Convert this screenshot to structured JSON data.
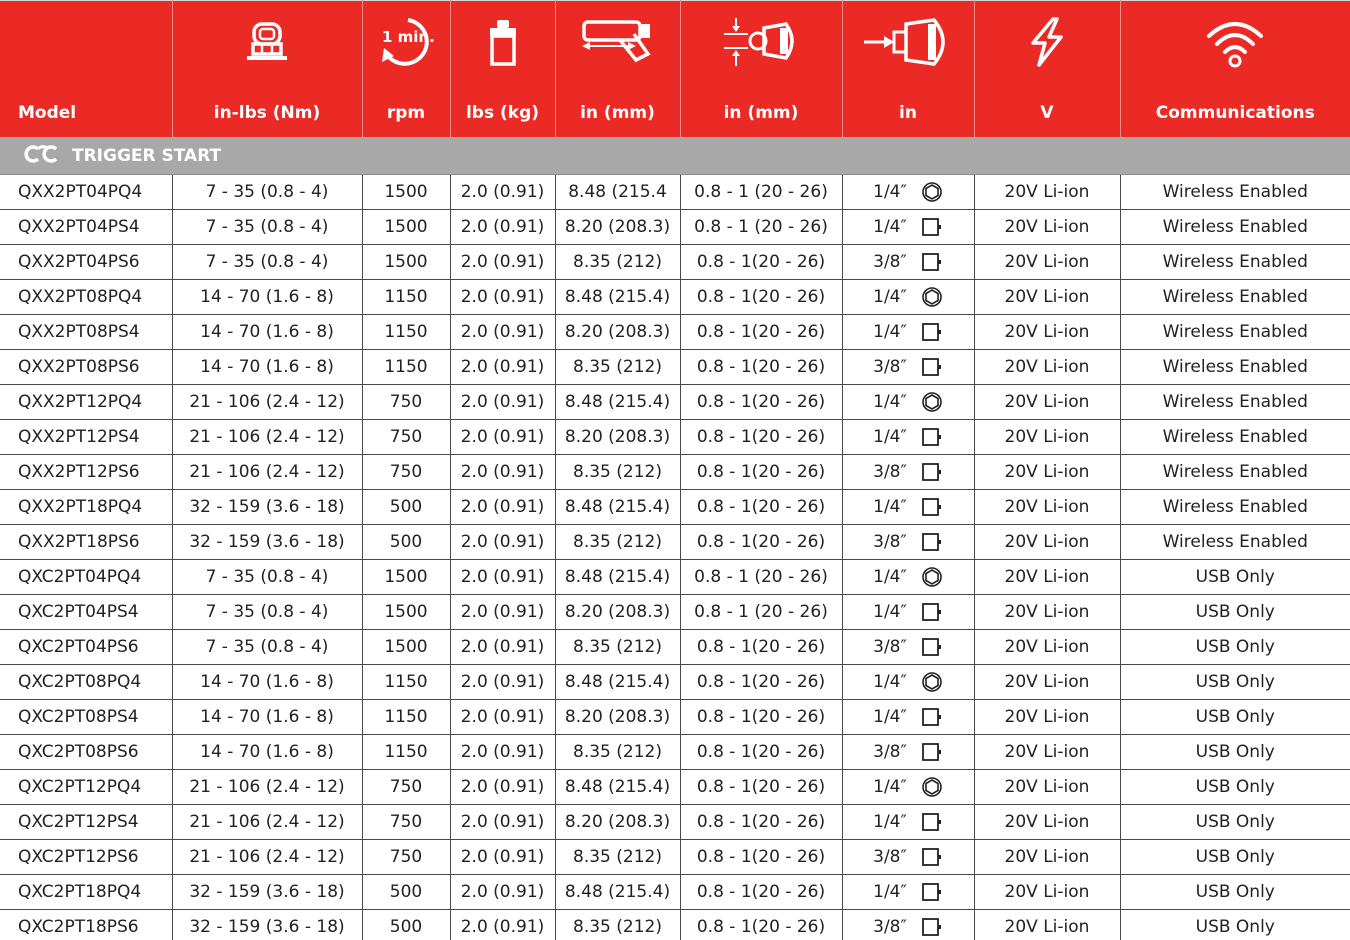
{
  "colors": {
    "header_bg": "#ec2a25",
    "section_bg": "#a8a8a8",
    "text": "#222222"
  },
  "headers": [
    {
      "label": "Model",
      "icon": ""
    },
    {
      "label": "in-lbs (Nm)",
      "icon": "torque-nut-icon"
    },
    {
      "label": "rpm",
      "icon": "rpm-clock-icon",
      "icon_text": "1 min."
    },
    {
      "label": "lbs (kg)",
      "icon": "weight-icon"
    },
    {
      "label": "in (mm)",
      "icon": "tool-length-icon"
    },
    {
      "label": "in (mm)",
      "icon": "center-distance-icon"
    },
    {
      "label": "in",
      "icon": "drive-square-icon"
    },
    {
      "label": "V",
      "icon": "lightning-icon"
    },
    {
      "label": "Communications",
      "icon": "wireless-icon"
    }
  ],
  "section": {
    "label": "TRIGGER START",
    "icon": "trigger-start-icon"
  },
  "rows": [
    {
      "model": "QXX2PT04PQ4",
      "torque": "7 - 35 (0.8 - 4)",
      "rpm": "1500",
      "weight": "2.0 (0.91)",
      "length": "8.48 (215.4",
      "center": "0.8 - 1 (20 - 26)",
      "drive": "1/4″",
      "drive_icon": "quick-change-icon",
      "voltage": "20V Li-ion",
      "comm": "Wireless Enabled"
    },
    {
      "model": "QXX2PT04PS4",
      "torque": "7 - 35 (0.8 - 4)",
      "rpm": "1500",
      "weight": "2.0 (0.91)",
      "length": "8.20 (208.3)",
      "center": "0.8 - 1 (20 - 26)",
      "drive": "1/4″",
      "drive_icon": "square-drive-icon",
      "voltage": "20V Li-ion",
      "comm": "Wireless Enabled"
    },
    {
      "model": "QXX2PT04PS6",
      "torque": "7 - 35 (0.8 - 4)",
      "rpm": "1500",
      "weight": "2.0 (0.91)",
      "length": "8.35 (212)",
      "center": "0.8 - 1(20 - 26)",
      "drive": "3/8″",
      "drive_icon": "square-drive-icon",
      "voltage": "20V Li-ion",
      "comm": "Wireless Enabled"
    },
    {
      "model": "QXX2PT08PQ4",
      "torque": "14 - 70 (1.6 - 8)",
      "rpm": "1150",
      "weight": "2.0 (0.91)",
      "length": "8.48 (215.4)",
      "center": "0.8 - 1(20 - 26)",
      "drive": "1/4″",
      "drive_icon": "quick-change-icon",
      "voltage": "20V Li-ion",
      "comm": "Wireless Enabled"
    },
    {
      "model": "QXX2PT08PS4",
      "torque": "14 - 70 (1.6 - 8)",
      "rpm": "1150",
      "weight": "2.0 (0.91)",
      "length": "8.20 (208.3)",
      "center": "0.8 - 1(20 - 26)",
      "drive": "1/4″",
      "drive_icon": "square-drive-icon",
      "voltage": "20V Li-ion",
      "comm": "Wireless Enabled"
    },
    {
      "model": "QXX2PT08PS6",
      "torque": "14 - 70 (1.6 - 8)",
      "rpm": "1150",
      "weight": "2.0 (0.91)",
      "length": "8.35 (212)",
      "center": "0.8 - 1(20 - 26)",
      "drive": "3/8″",
      "drive_icon": "square-drive-icon",
      "voltage": "20V Li-ion",
      "comm": "Wireless Enabled"
    },
    {
      "model": "QXX2PT12PQ4",
      "torque": "21 - 106 (2.4 - 12)",
      "rpm": "750",
      "weight": "2.0 (0.91)",
      "length": "8.48 (215.4)",
      "center": "0.8 - 1(20 - 26)",
      "drive": "1/4″",
      "drive_icon": "quick-change-icon",
      "voltage": "20V Li-ion",
      "comm": "Wireless Enabled"
    },
    {
      "model": "QXX2PT12PS4",
      "torque": "21 - 106 (2.4 - 12)",
      "rpm": "750",
      "weight": "2.0 (0.91)",
      "length": "8.20 (208.3)",
      "center": "0.8 - 1(20 - 26)",
      "drive": "1/4″",
      "drive_icon": "square-drive-icon",
      "voltage": "20V Li-ion",
      "comm": "Wireless Enabled"
    },
    {
      "model": "QXX2PT12PS6",
      "torque": "21 - 106 (2.4 - 12)",
      "rpm": "750",
      "weight": "2.0 (0.91)",
      "length": "8.35 (212)",
      "center": "0.8 - 1(20 - 26)",
      "drive": "3/8″",
      "drive_icon": "square-drive-icon",
      "voltage": "20V Li-ion",
      "comm": "Wireless Enabled"
    },
    {
      "model": "QXX2PT18PQ4",
      "torque": "32 - 159 (3.6 - 18)",
      "rpm": "500",
      "weight": "2.0 (0.91)",
      "length": "8.48 (215.4)",
      "center": "0.8 - 1(20 - 26)",
      "drive": "1/4″",
      "drive_icon": "square-drive-icon",
      "voltage": "20V Li-ion",
      "comm": "Wireless Enabled"
    },
    {
      "model": "QXX2PT18PS6",
      "torque": "32 - 159 (3.6 - 18)",
      "rpm": "500",
      "weight": "2.0 (0.91)",
      "length": "8.35 (212)",
      "center": "0.8 - 1(20 - 26)",
      "drive": "3/8″",
      "drive_icon": "square-drive-icon",
      "voltage": "20V Li-ion",
      "comm": "Wireless Enabled"
    },
    {
      "model": "QXC2PT04PQ4",
      "torque": "7 - 35 (0.8 - 4)",
      "rpm": "1500",
      "weight": "2.0 (0.91)",
      "length": "8.48 (215.4)",
      "center": "0.8 - 1 (20 - 26)",
      "drive": "1/4″",
      "drive_icon": "quick-change-icon",
      "voltage": "20V Li-ion",
      "comm": "USB Only"
    },
    {
      "model": "QXC2PT04PS4",
      "torque": "7 - 35 (0.8 - 4)",
      "rpm": "1500",
      "weight": "2.0 (0.91)",
      "length": "8.20 (208.3)",
      "center": "0.8 - 1 (20 - 26)",
      "drive": "1/4″",
      "drive_icon": "square-drive-icon",
      "voltage": "20V Li-ion",
      "comm": "USB Only"
    },
    {
      "model": "QXC2PT04PS6",
      "torque": "7 - 35 (0.8 - 4)",
      "rpm": "1500",
      "weight": "2.0 (0.91)",
      "length": "8.35 (212)",
      "center": "0.8 - 1(20 - 26)",
      "drive": "3/8″",
      "drive_icon": "square-drive-icon",
      "voltage": "20V Li-ion",
      "comm": "USB Only"
    },
    {
      "model": "QXC2PT08PQ4",
      "torque": "14 - 70 (1.6 - 8)",
      "rpm": "1150",
      "weight": "2.0 (0.91)",
      "length": "8.48 (215.4)",
      "center": "0.8 - 1(20 - 26)",
      "drive": "1/4″",
      "drive_icon": "quick-change-icon",
      "voltage": "20V Li-ion",
      "comm": "USB Only"
    },
    {
      "model": "QXC2PT08PS4",
      "torque": "14 - 70 (1.6 - 8)",
      "rpm": "1150",
      "weight": "2.0 (0.91)",
      "length": "8.20 (208.3)",
      "center": "0.8 - 1(20 - 26)",
      "drive": "1/4″",
      "drive_icon": "square-drive-icon",
      "voltage": "20V Li-ion",
      "comm": "USB Only"
    },
    {
      "model": "QXC2PT08PS6",
      "torque": "14 - 70 (1.6 - 8)",
      "rpm": "1150",
      "weight": "2.0 (0.91)",
      "length": "8.35 (212)",
      "center": "0.8 - 1(20 - 26)",
      "drive": "3/8″",
      "drive_icon": "square-drive-icon",
      "voltage": "20V Li-ion",
      "comm": "USB Only"
    },
    {
      "model": "QXC2PT12PQ4",
      "torque": "21 - 106 (2.4 - 12)",
      "rpm": "750",
      "weight": "2.0 (0.91)",
      "length": "8.48 (215.4)",
      "center": "0.8 - 1(20 - 26)",
      "drive": "1/4″",
      "drive_icon": "quick-change-icon",
      "voltage": "20V Li-ion",
      "comm": "USB Only"
    },
    {
      "model": "QXC2PT12PS4",
      "torque": "21 - 106 (2.4 - 12)",
      "rpm": "750",
      "weight": "2.0 (0.91)",
      "length": "8.20 (208.3)",
      "center": "0.8 - 1(20 - 26)",
      "drive": "1/4″",
      "drive_icon": "square-drive-icon",
      "voltage": "20V Li-ion",
      "comm": "USB Only"
    },
    {
      "model": "QXC2PT12PS6",
      "torque": "21 - 106 (2.4 - 12)",
      "rpm": "750",
      "weight": "2.0 (0.91)",
      "length": "8.35 (212)",
      "center": "0.8 - 1(20 - 26)",
      "drive": "3/8″",
      "drive_icon": "square-drive-icon",
      "voltage": "20V Li-ion",
      "comm": "USB Only"
    },
    {
      "model": "QXC2PT18PQ4",
      "torque": "32 - 159 (3.6 - 18)",
      "rpm": "500",
      "weight": "2.0 (0.91)",
      "length": "8.48 (215.4)",
      "center": "0.8 - 1(20 - 26)",
      "drive": "1/4″",
      "drive_icon": "square-drive-icon",
      "voltage": "20V Li-ion",
      "comm": "USB Only"
    },
    {
      "model": "QXC2PT18PS6",
      "torque": "32 - 159 (3.6 - 18)",
      "rpm": "500",
      "weight": "2.0 (0.91)",
      "length": "8.35 (212)",
      "center": "0.8 - 1(20 - 26)",
      "drive": "3/8″",
      "drive_icon": "square-drive-icon",
      "voltage": "20V Li-ion",
      "comm": "USB Only"
    }
  ]
}
